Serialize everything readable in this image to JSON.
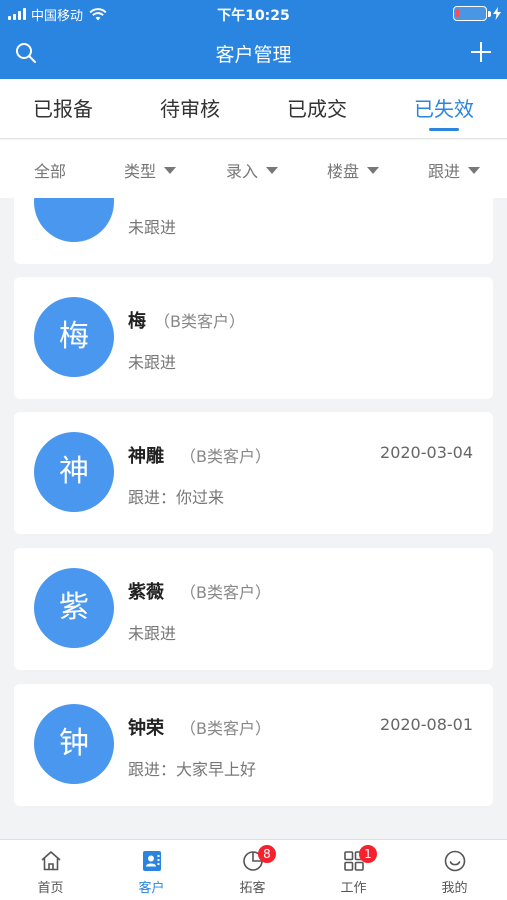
{
  "status_bar": {
    "carrier": "中国移动",
    "time": "下午10:25"
  },
  "header": {
    "title": "客户管理",
    "left_icon": "search-icon",
    "right_icon": "plus-icon"
  },
  "tabs": [
    {
      "label": "已报备",
      "active": false
    },
    {
      "label": "待审核",
      "active": false
    },
    {
      "label": "已成交",
      "active": false
    },
    {
      "label": "已失效",
      "active": true
    }
  ],
  "filters": [
    {
      "label": "全部",
      "has_dropdown": false
    },
    {
      "label": "类型",
      "has_dropdown": true
    },
    {
      "label": "录入",
      "has_dropdown": true
    },
    {
      "label": "楼盘",
      "has_dropdown": true
    },
    {
      "label": "跟进",
      "has_dropdown": true
    }
  ],
  "customers": [
    {
      "avatar": "",
      "name": "",
      "type": "",
      "date": "",
      "status": "未跟进"
    },
    {
      "avatar": "梅",
      "name": "梅",
      "type": "（B类客户）",
      "date": "",
      "status": "未跟进"
    },
    {
      "avatar": "神",
      "name": "神雕",
      "type": "（B类客户）",
      "date": "2020-03-04",
      "status": "跟进：你过来"
    },
    {
      "avatar": "紫",
      "name": "紫薇",
      "type": "（B类客户）",
      "date": "",
      "status": "未跟进"
    },
    {
      "avatar": "钟",
      "name": "钟荣",
      "type": "（B类客户）",
      "date": "2020-08-01",
      "status": "跟进：大家早上好"
    }
  ],
  "bottom_nav": [
    {
      "label": "首页",
      "icon": "home-icon",
      "active": false,
      "badge": ""
    },
    {
      "label": "客户",
      "icon": "contacts-icon",
      "active": true,
      "badge": ""
    },
    {
      "label": "拓客",
      "icon": "pie-chart-icon",
      "active": false,
      "badge": "8"
    },
    {
      "label": "工作",
      "icon": "grid-icon",
      "active": false,
      "badge": "1"
    },
    {
      "label": "我的",
      "icon": "smile-icon",
      "active": false,
      "badge": ""
    }
  ],
  "colors": {
    "primary": "#2a85e0",
    "avatar": "#4a97f0",
    "badge": "#f5222d",
    "background": "#f2f3f5"
  }
}
